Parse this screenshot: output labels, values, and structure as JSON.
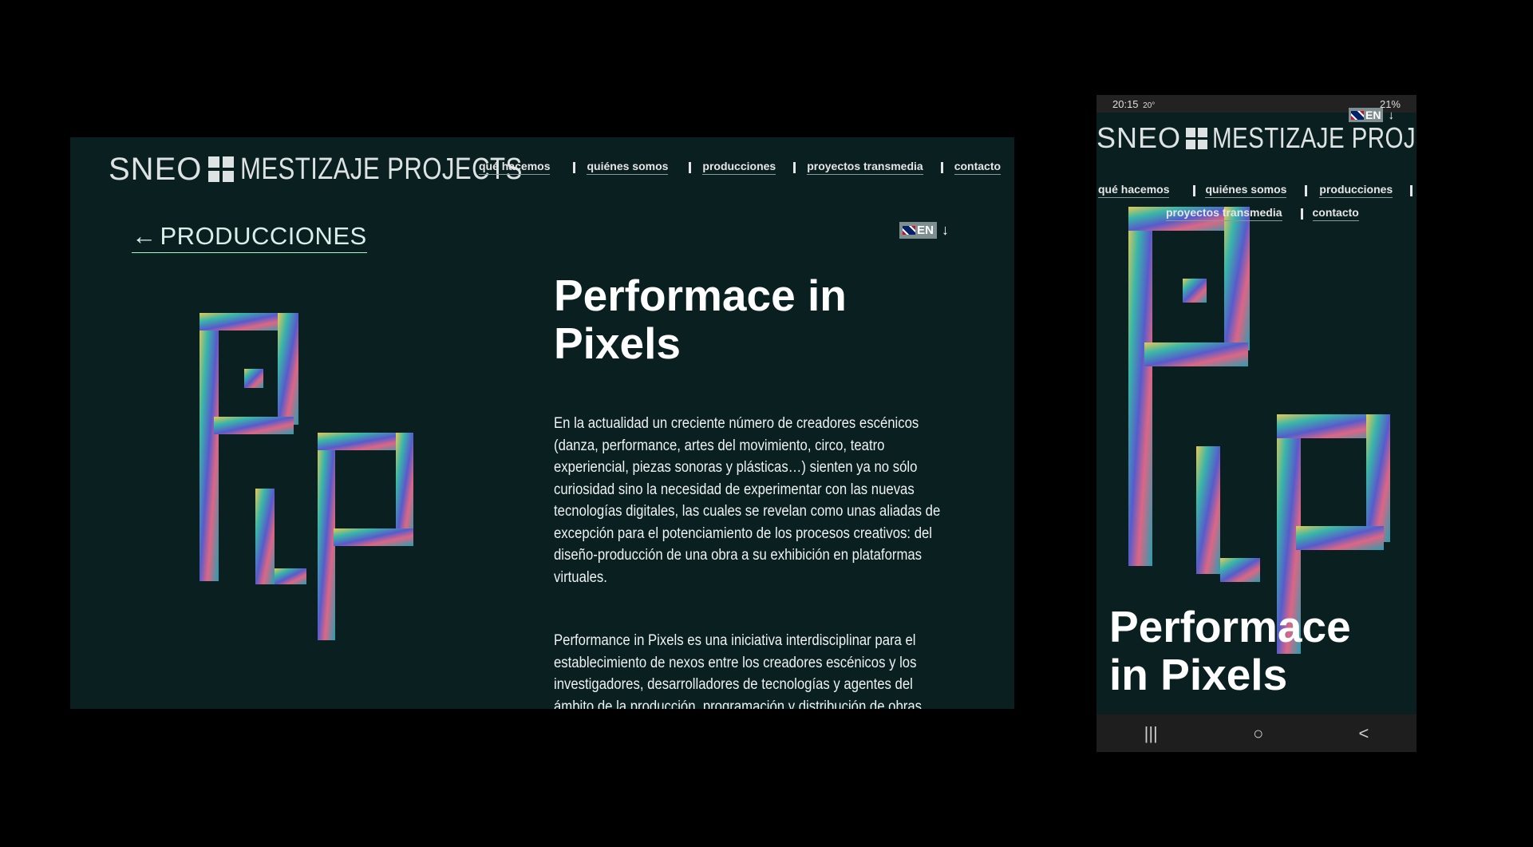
{
  "brand": {
    "sneo": "SNEO",
    "projects": "MESTIZAJE PROJECTS"
  },
  "nav": [
    "qué hacemos",
    "quiénes somos",
    "producciones",
    "proyectos transmedia",
    "contacto"
  ],
  "back_link": {
    "arrow": "←",
    "label": "PRODUCCIONES"
  },
  "language": {
    "code": "EN",
    "arrow": "↓"
  },
  "article": {
    "title_line1": "Performace in",
    "title_line2": "Pixels",
    "mobile_title_line1": "Performace",
    "mobile_title_line2": "in Pixels",
    "paragraph1": "En la actualidad un creciente número de creadores escénicos (danza, performance, artes del movimiento, circo, teatro experiencial, piezas sonoras y plásticas…) sienten ya no sólo curiosidad sino la necesidad de experimentar con las nuevas tecnologías digitales, las cuales se revelan como unas aliadas de excepción para el potenciamiento de los procesos creativos: del diseño-producción de una obra a su exhibición en plataformas virtuales.",
    "paragraph2": "Performance in Pixels es una iniciativa interdisciplinar para el establecimiento de nexos entre los creadores escénicos y los investigadores, desarrolladores de tecnologías y agentes del ámbito de la producción, programación y distribución de obras"
  },
  "phone_status": {
    "time": "20:15",
    "temp": "20°",
    "battery": "21%"
  },
  "phone_nav": {
    "recent": "|||",
    "home": "○",
    "back": "<"
  },
  "colors": {
    "background": "#0a1f20",
    "text": "#ffffff"
  }
}
